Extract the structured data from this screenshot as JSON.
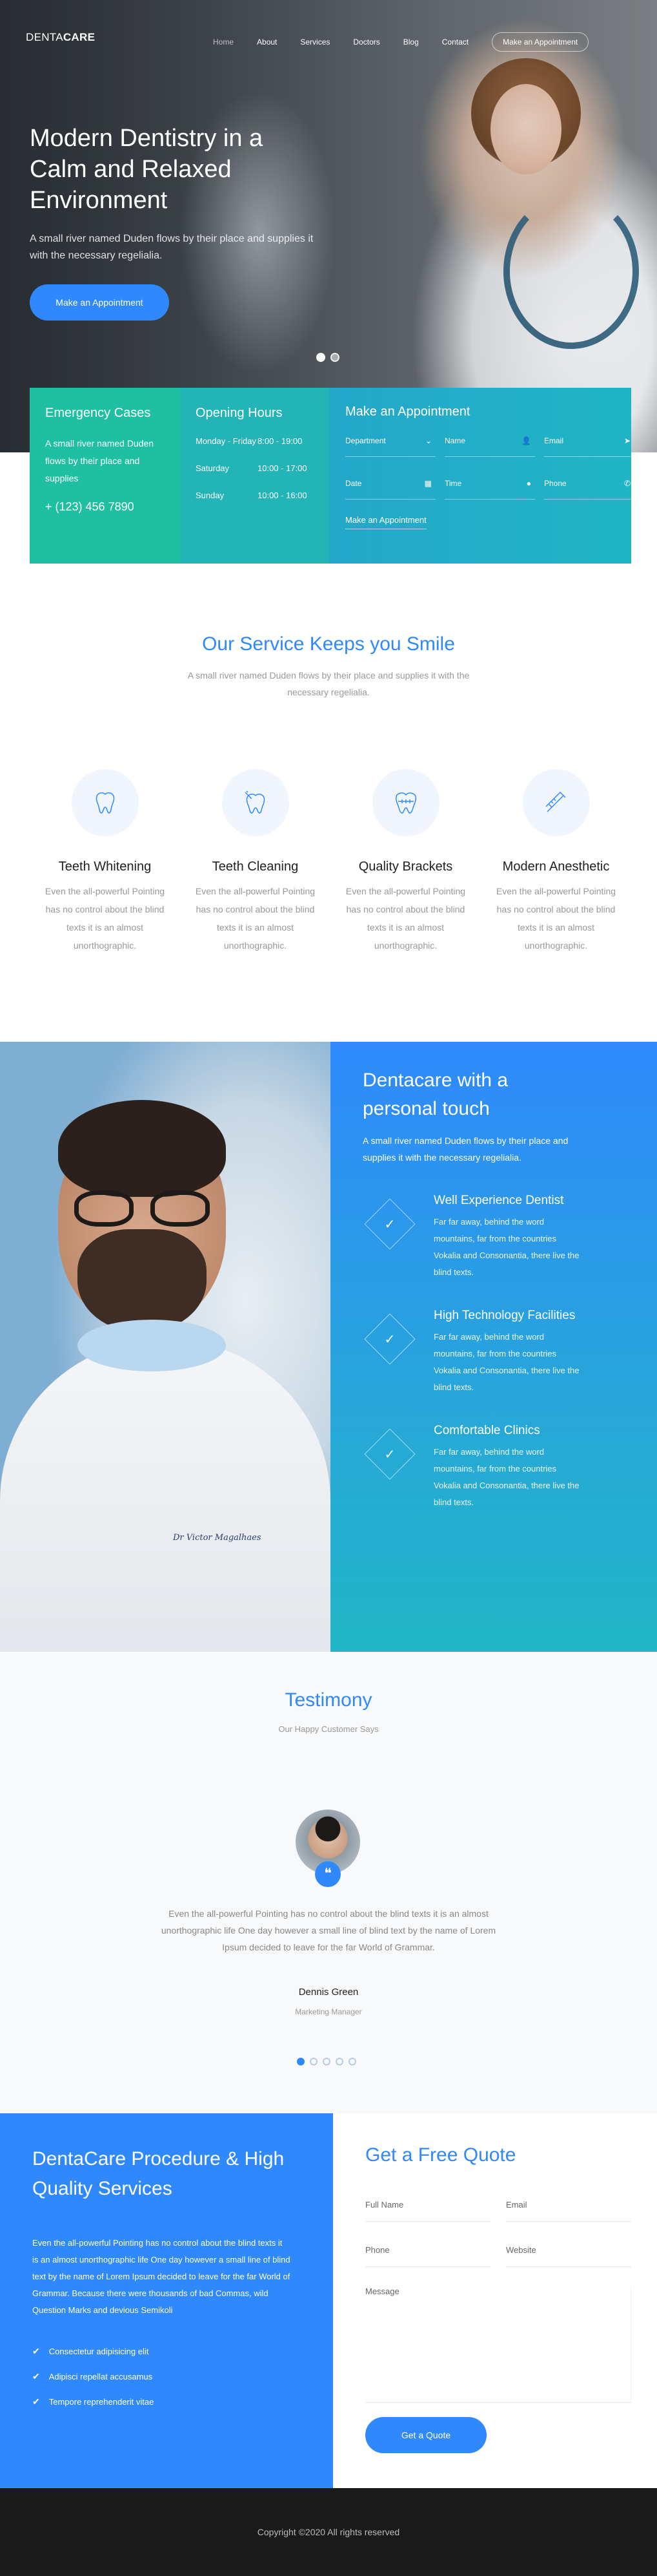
{
  "brand": {
    "name_light": "DENTA",
    "name_bold": "CARE"
  },
  "nav": {
    "items": [
      "Home",
      "About",
      "Services",
      "Doctors",
      "Blog",
      "Contact"
    ],
    "cta": "Make an Appointment"
  },
  "hero": {
    "title": "Modern Dentistry in a Calm and Relaxed Environment",
    "subtitle": "A small river named Duden flows by their place and supplies it with the necessary regelialia.",
    "button": "Make an Appointment",
    "slides_total": 2,
    "active_slide": 1
  },
  "info": {
    "emergency": {
      "title": "Emergency Cases",
      "text": "A small river named Duden flows by their place and supplies",
      "phone": "+ (123) 456 7890"
    },
    "hours": {
      "title": "Opening Hours",
      "rows": [
        {
          "day": "Monday - Friday",
          "time": "8:00 - 19:00"
        },
        {
          "day": "Saturday",
          "time": "10:00 - 17:00"
        },
        {
          "day": "Sunday",
          "time": "10:00 - 16:00"
        }
      ]
    },
    "appointment": {
      "title": "Make an Appointment",
      "fields": {
        "department": "Department",
        "name": "Name",
        "email": "Email",
        "date": "Date",
        "time": "Time",
        "phone": "Phone"
      },
      "submit": "Make an Appointment"
    }
  },
  "services": {
    "title": "Our Service Keeps you Smile",
    "subtitle": "A small river named Duden flows by their place and supplies it with the necessary regelialia.",
    "items": [
      {
        "title": "Teeth Whitening",
        "text": "Even the all-powerful Pointing has no control about the blind texts it is an almost unorthographic.",
        "icon": "tooth-icon"
      },
      {
        "title": "Teeth Cleaning",
        "text": "Even the all-powerful Pointing has no control about the blind texts it is an almost unorthographic.",
        "icon": "tooth-cleaning-icon"
      },
      {
        "title": "Quality Brackets",
        "text": "Even the all-powerful Pointing has no control about the blind texts it is an almost unorthographic.",
        "icon": "brackets-icon"
      },
      {
        "title": "Modern Anesthetic",
        "text": "Even the all-powerful Pointing has no control about the blind texts it is an almost unorthographic.",
        "icon": "syringe-icon"
      }
    ]
  },
  "personal": {
    "doctor_tag": "Dr Victor Magalhaes",
    "title": "Dentacare with a personal touch",
    "lead": "A small river named Duden flows by their place and supplies it with the necessary regelialia.",
    "features": [
      {
        "title": "Well Experience Dentist",
        "text": "Far far away, behind the word mountains, far from the countries Vokalia and Consonantia, there live the blind texts."
      },
      {
        "title": "High Technology Facilities",
        "text": "Far far away, behind the word mountains, far from the countries Vokalia and Consonantia, there live the blind texts."
      },
      {
        "title": "Comfortable Clinics",
        "text": "Far far away, behind the word mountains, far from the countries Vokalia and Consonantia, there live the blind texts."
      }
    ]
  },
  "testimony": {
    "title": "Testimony",
    "subtitle": "Our Happy Customer Says",
    "quote_mark": "❝",
    "quote": "Even the all-powerful Pointing has no control about the blind texts it is an almost unorthographic life One day however a small line of blind text by the name of Lorem Ipsum decided to leave for the far World of Grammar.",
    "name": "Dennis Green",
    "role": "Marketing Manager",
    "pages_total": 5,
    "active_page": 1
  },
  "procedure": {
    "title": "DentaCare Procedure & High Quality Services",
    "text": "Even the all-powerful Pointing has no control about the blind texts it is an almost unorthographic life One day however a small line of blind text by the name of Lorem Ipsum decided to leave for the far World of Grammar. Because there were thousands of bad Commas, wild Question Marks and devious Semikoli",
    "list": [
      "Consectetur adipisicing elit",
      "Adipisci repellat accusamus",
      "Tempore reprehenderit vitae"
    ]
  },
  "quote_form": {
    "title": "Get a Free Quote",
    "full_name": "Full Name",
    "email": "Email",
    "phone": "Phone",
    "website": "Website",
    "message": "Message",
    "button": "Get a Quote"
  },
  "footer": {
    "copyright": "Copyright ©2020 All rights reserved"
  },
  "colors": {
    "accent": "#2f89fc",
    "teal": "#1fbfa2",
    "footer": "#1a1a1a"
  }
}
